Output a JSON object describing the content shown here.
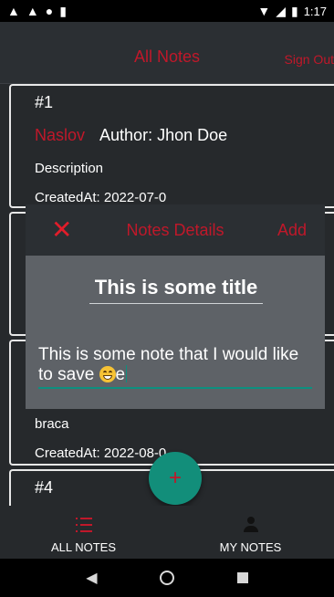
{
  "status_bar": {
    "time": "1:17",
    "left_icons": [
      "alert-icon",
      "alert-icon",
      "circle-icon",
      "sim-icon"
    ],
    "right_icons": [
      "wifi-icon",
      "signal-icon",
      "battery-icon"
    ]
  },
  "header": {
    "title": "All Notes",
    "sign_out": "Sign Out"
  },
  "notes": [
    {
      "number": "#1",
      "title": "Naslov",
      "author": "Author: Jhon Doe",
      "description": "Description",
      "created": "CreatedAt: 2022-07-0"
    },
    {
      "number": "",
      "description": "braca",
      "created": "CreatedAt: 2022-08-0"
    },
    {
      "number": "#4"
    }
  ],
  "dialog": {
    "title": "Notes Details",
    "add_label": "Add",
    "close_icon": "close-icon",
    "title_value": "This is some title",
    "text_value_prefix": "This is some note that I would like to save ",
    "text_value_suffix": "e",
    "emoji": "grinning-face-emoji"
  },
  "fab": {
    "icon": "plus-icon"
  },
  "bottom_nav": {
    "items": [
      {
        "label": "ALL NOTES",
        "icon": "list-icon",
        "active": true
      },
      {
        "label": "MY NOTES",
        "icon": "person-icon",
        "active": false
      }
    ]
  },
  "system_nav": {
    "icons": [
      "back-icon",
      "home-icon",
      "recents-icon"
    ]
  },
  "colors": {
    "accent_red": "#c0182a",
    "fab_teal": "#128e7a",
    "background": "#26292c",
    "dialog_body": "#5e6267"
  }
}
